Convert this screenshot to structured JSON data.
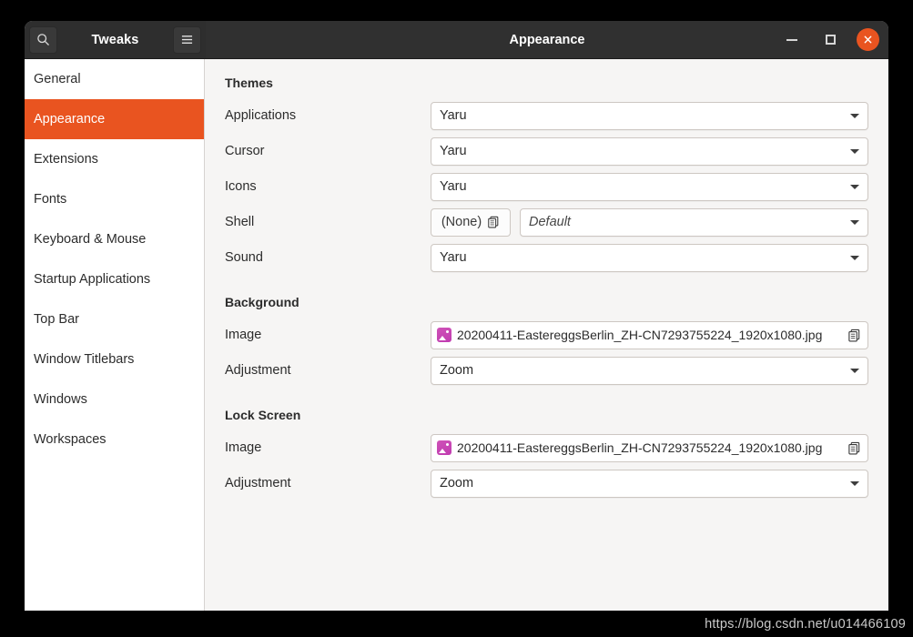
{
  "window": {
    "app_title": "Tweaks",
    "page_title": "Appearance",
    "search_icon": "search-icon",
    "menu_icon": "hamburger-menu-icon",
    "minimize_label": "Minimize",
    "maximize_label": "Maximize",
    "close_label": "Close",
    "accent_color": "#e95420",
    "headerbar_color": "#303030"
  },
  "sidebar": {
    "items": [
      {
        "label": "General",
        "selected": false
      },
      {
        "label": "Appearance",
        "selected": true
      },
      {
        "label": "Extensions",
        "selected": false
      },
      {
        "label": "Fonts",
        "selected": false
      },
      {
        "label": "Keyboard & Mouse",
        "selected": false
      },
      {
        "label": "Startup Applications",
        "selected": false
      },
      {
        "label": "Top Bar",
        "selected": false
      },
      {
        "label": "Window Titlebars",
        "selected": false
      },
      {
        "label": "Windows",
        "selected": false
      },
      {
        "label": "Workspaces",
        "selected": false
      }
    ]
  },
  "content": {
    "themes": {
      "title": "Themes",
      "rows": [
        {
          "label": "Applications",
          "value": "Yaru",
          "control": "combo"
        },
        {
          "label": "Cursor",
          "value": "Yaru",
          "control": "combo"
        },
        {
          "label": "Icons",
          "value": "Yaru",
          "control": "combo"
        },
        {
          "label": "Shell",
          "value": "Default",
          "control": "shell",
          "none_label": "(None)",
          "italic": true
        },
        {
          "label": "Sound",
          "value": "Yaru",
          "control": "combo"
        }
      ]
    },
    "background": {
      "title": "Background",
      "image_label": "Image",
      "image_value": "20200411-EastereggsBerlin_ZH-CN7293755224_1920x1080.jpg",
      "adjustment_label": "Adjustment",
      "adjustment_value": "Zoom"
    },
    "lockscreen": {
      "title": "Lock Screen",
      "image_label": "Image",
      "image_value": "20200411-EastereggsBerlin_ZH-CN7293755224_1920x1080.jpg",
      "adjustment_label": "Adjustment",
      "adjustment_value": "Zoom"
    }
  },
  "watermark": "https://blog.csdn.net/u014466109"
}
